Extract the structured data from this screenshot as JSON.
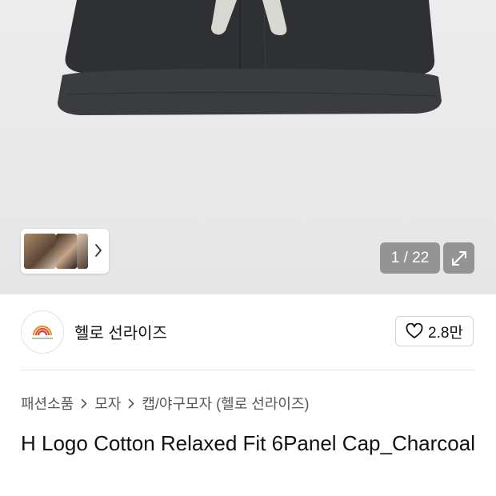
{
  "gallery": {
    "counter": "1 / 22",
    "expand_icon": "expand-icon",
    "thumbnail_chevron_icon": "chevron-right-icon"
  },
  "brand": {
    "name": "헬로 선라이즈",
    "logo_icon": "brand-logo-icon",
    "like_count": "2.8만",
    "like_icon": "heart-icon"
  },
  "breadcrumb": {
    "items": [
      "패션소품",
      "모자",
      "캡/야구모자 (헬로 선라이즈)"
    ],
    "separator_icon": "chevron-right-icon"
  },
  "product": {
    "title": "H Logo Cotton Relaxed Fit 6Panel Cap_Charcoal"
  },
  "colors": {
    "cap": "#2e3033",
    "accent_text": "#111111",
    "muted_text": "#555555",
    "overlay": "#787878"
  }
}
